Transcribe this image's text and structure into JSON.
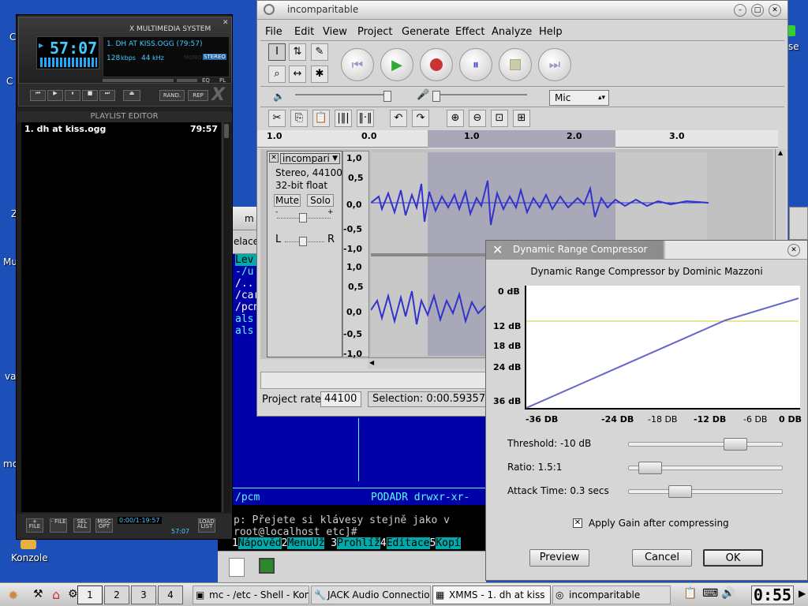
{
  "desktop": {
    "icon_labels": [
      "C",
      "C",
      "Z",
      "Mu",
      "va",
      "mc"
    ],
    "konzole_label": "Konzole",
    "right_fragment": "se"
  },
  "terminal": {
    "title_fragment": "m",
    "tab_fragment": "elace",
    "lines": [
      "Lev",
      "-/u",
      "",
      "/..",
      "/car",
      "/pcm",
      " als",
      " als"
    ],
    "status_left": "/pcm",
    "status_right": "PODADR drwxr-xr-",
    "prompt_line": "p: Přejete si klávesy stejně jako v",
    "shell_line": "root@localhost etc]# ",
    "fkeys": [
      {
        "num": "1",
        "label": "Nápověd"
      },
      {
        "num": "2",
        "label": "MenuUž"
      },
      {
        "num": "3",
        "label": "Prohlíž"
      },
      {
        "num": "4",
        "label": "Editace"
      },
      {
        "num": "5",
        "label": "Kopí"
      }
    ]
  },
  "xmms": {
    "brand": "X MULTIMEDIA SYSTEM",
    "time": "57:07",
    "song": "1. DH AT KISS.OGG (79:57)",
    "bitrate": "128",
    "bitrate_unit": "kbps",
    "samplerate": "44",
    "samplerate_unit": "kHz",
    "mono": "MONO",
    "stereo": "STEREO",
    "eq": "EQ",
    "pl": "PL",
    "rand": "RAND.",
    "rep": "REP",
    "playlist_title": "PLAYLIST EDITOR",
    "playlist": [
      {
        "title": "1. dh at kiss.ogg",
        "duration": "79:57"
      }
    ],
    "footer_buttons": [
      "+ FILE",
      "- FILE",
      "SEL ALL",
      "MISC OPT",
      "LOAD LIST"
    ],
    "footer_time": "0:00/1:19:57",
    "footer_time2": "57:07"
  },
  "audacity": {
    "title": "incomparitable",
    "menu": [
      "File",
      "Edit",
      "View",
      "Project",
      "Generate",
      "Effect",
      "Analyze",
      "Help"
    ],
    "input_source": "Mic",
    "ruler_ticks": [
      "1.0",
      "0.0",
      "1.0",
      "2.0",
      "3.0"
    ],
    "track": {
      "name": "incompari",
      "format": "Stereo, 44100 Hz",
      "bits": "32-bit float",
      "mute": "Mute",
      "solo": "Solo",
      "gain_minus": "-",
      "gain_plus": "+",
      "pan_l": "L",
      "pan_r": "R",
      "y_labels": [
        "1,0",
        "0,5",
        "0,0",
        "-0,5",
        "-1,0"
      ]
    },
    "project_rate_label": "Project rate:",
    "project_rate": "44100",
    "selection": "Selection: 0:00.593570"
  },
  "compressor": {
    "title": "Dynamic Range Compressor",
    "heading": "Dynamic Range Compressor by Dominic Mazzoni",
    "y_ticks": [
      "0 dB",
      "12 dB",
      "18 dB",
      "24 dB",
      "36 dB"
    ],
    "x_ticks": [
      "-36 DB",
      "-24 DB",
      "-18 DB",
      "-12 DB",
      "-6 DB",
      "0 DB"
    ],
    "threshold_label": "Threshold: -10 dB",
    "threshold": 0.72,
    "ratio_label": "Ratio: 1.5:1",
    "ratio": 0.07,
    "attack_label": "Attack Time: 0.3 secs",
    "attack": 0.3,
    "apply_gain_label": "Apply Gain after compressing",
    "apply_gain_checked": true,
    "preview": "Preview",
    "cancel": "Cancel",
    "ok": "OK",
    "curve_color": "#6666cc",
    "threshold_color": "#cccc33"
  },
  "taskbar": {
    "pager": [
      "1",
      "2",
      "3",
      "4"
    ],
    "tasks": [
      {
        "label": "mc - /etc - Shell - Kon",
        "active": false
      },
      {
        "label": "JACK Audio Connectio",
        "active": false
      },
      {
        "label": "XMMS - 1. dh at kiss",
        "active": true
      },
      {
        "label": "incomparitable",
        "active": false
      }
    ],
    "clock": "0:55"
  }
}
